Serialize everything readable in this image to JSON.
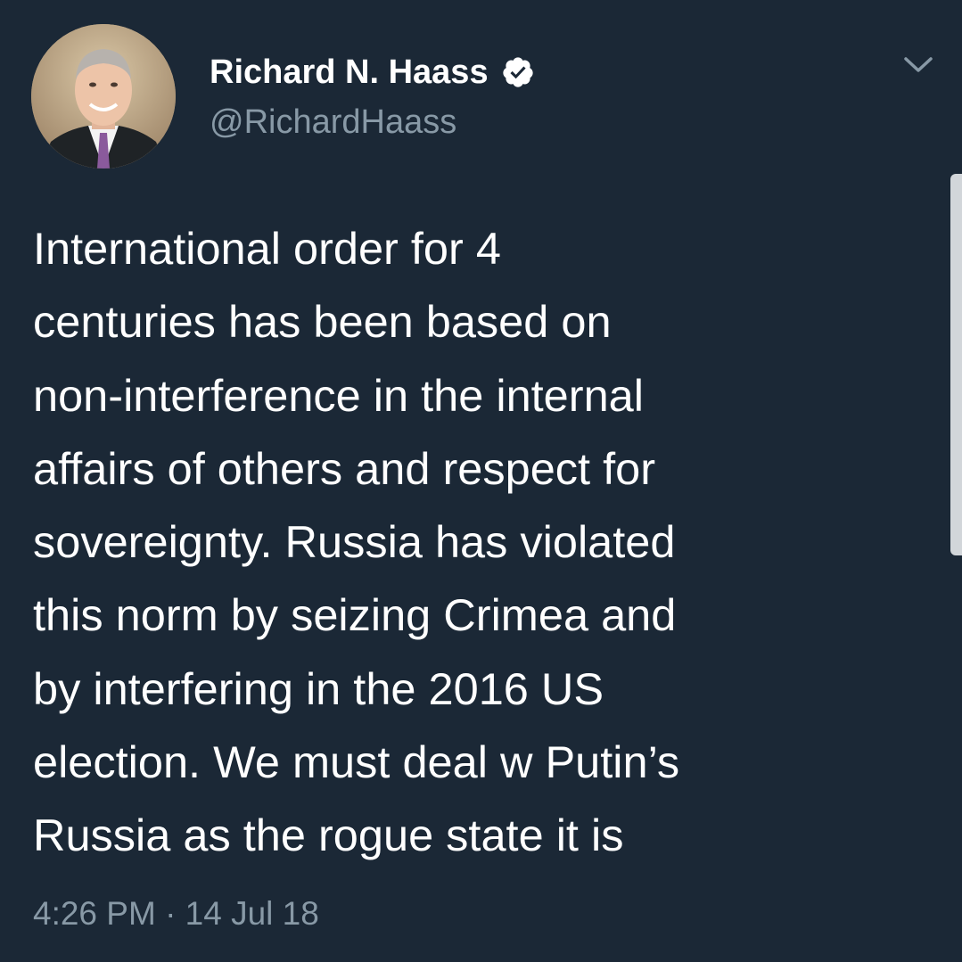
{
  "user": {
    "display_name": "Richard N. Haass",
    "handle": "@RichardHaass",
    "verified": true,
    "avatar_icon": "profile-photo"
  },
  "tweet": {
    "lines": [
      "International order for 4",
      "centuries has been based on",
      "non-interference in the internal",
      "affairs of others and respect for",
      "sovereignty. Russia has violated",
      "this norm by seizing Crimea and",
      "by interfering in the 2016 US",
      "election. We must deal w Putin’s",
      "Russia as the rogue state it is"
    ],
    "timestamp": "4:26 PM · 14 Jul 18"
  },
  "icons": {
    "menu": "chevron-down-icon",
    "badge": "verified-badge-icon"
  },
  "colors": {
    "background": "#1b2836",
    "text": "#ffffff",
    "secondary_text": "#8899a6",
    "verified_badge": "#ffffff"
  }
}
